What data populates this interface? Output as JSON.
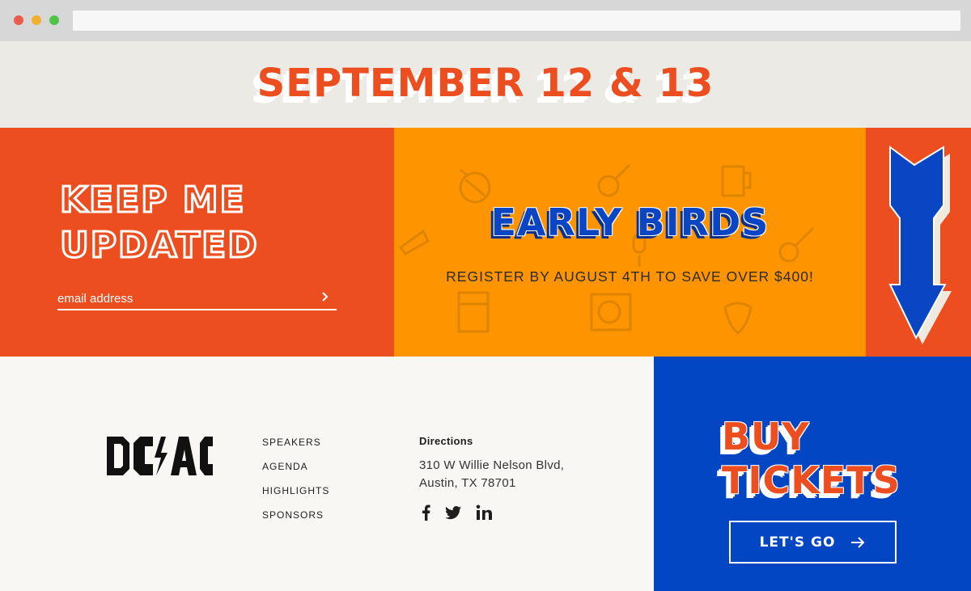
{
  "browser": {
    "url": ""
  },
  "banner": {
    "date": "SEPTEMBER 12 & 13"
  },
  "newsletter": {
    "title_line1": "KEEP ME",
    "title_line2": "UPDATED",
    "email_placeholder": "email address",
    "submit_icon": "chevron-right-icon"
  },
  "promo": {
    "title": "EARLY BIRDS",
    "subtitle": "REGISTER BY AUGUST 4TH TO SAVE OVER $400!",
    "background_icons": [
      "drum-icon",
      "guitar-icon",
      "beer-mug-icon",
      "trumpet-icon",
      "amplifier-icon",
      "turntable-icon",
      "electric-guitar-icon",
      "microphone-icon",
      "guitar-pick-icon"
    ],
    "arrow_icon": "down-arrow-icon"
  },
  "footer": {
    "logo_alt": "DC/AC",
    "nav": [
      "SPEAKERS",
      "AGENDA",
      "HIGHLIGHTS",
      "SPONSORS"
    ],
    "directions_title": "Directions",
    "address_line1": "310 W Willie Nelson Blvd,",
    "address_line2": "Austin, TX 78701",
    "social": [
      "facebook-icon",
      "twitter-icon",
      "linkedin-icon"
    ]
  },
  "cta": {
    "title_line1": "BUY",
    "title_line2": "TICKETS",
    "button_label": "LET'S GO",
    "button_icon": "arrow-right-icon"
  },
  "colors": {
    "orange_red": "#ec4e20",
    "orange": "#fe9500",
    "blue": "#0346c4",
    "cream": "#ebeae4",
    "offwhite": "#f9f7f4"
  }
}
